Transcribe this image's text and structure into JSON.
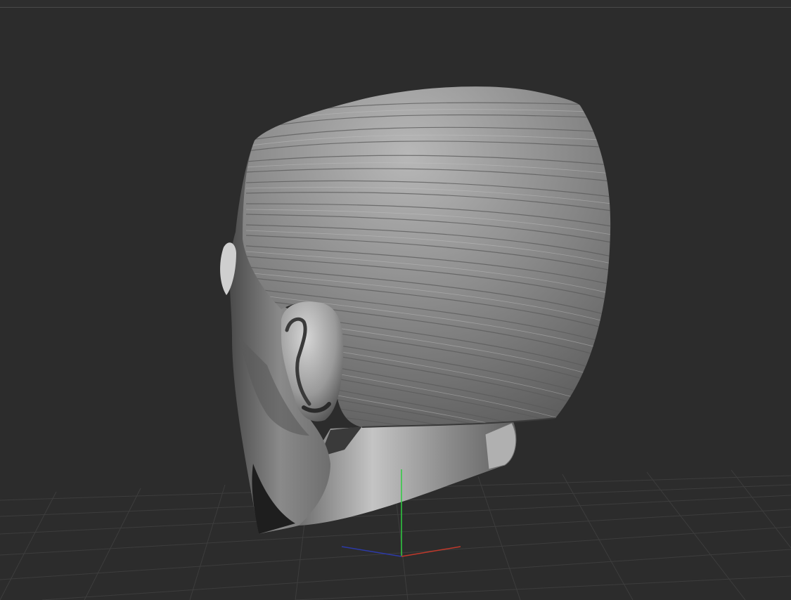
{
  "viewport": {
    "background_color": "#2c2c2c",
    "divider_color": "#4a4a4a",
    "grid_color": "#3d3d3d",
    "model_base_color": "#8c8c8c",
    "model_highlight_color": "#bdbdbd",
    "model_shadow_color": "#262626"
  },
  "gizmo": {
    "x_axis_color": "#c0392b",
    "y_axis_color": "#2ecc40",
    "z_axis_color": "#2c3aa8"
  },
  "model": {
    "icon": "sculpted-head-model"
  }
}
